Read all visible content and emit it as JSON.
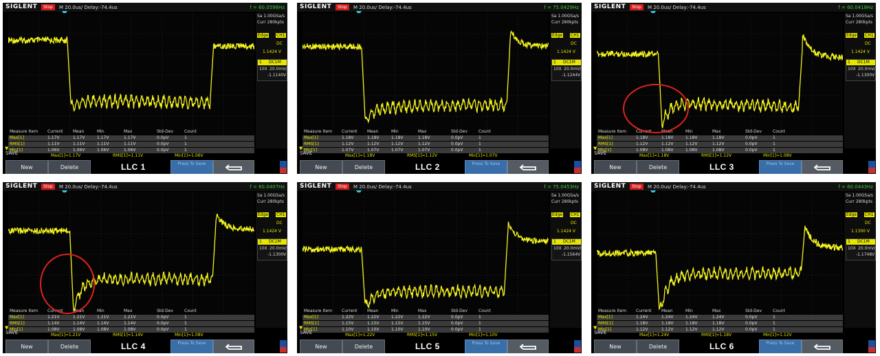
{
  "common": {
    "brand": "SIGLENT",
    "state": "Stop",
    "timebase": "M 20.0us/",
    "delay": "Delay:-74.4us",
    "sample_rate": "Sa 1.00GSa/s",
    "memory": "Curr 280kpts",
    "trigger_type": "Edge",
    "trigger_source": "CH1",
    "coupling": "DC",
    "ch_probe": "10X",
    "ch_scale": "20.0mV/",
    "ch_coupling": "DC1M",
    "ch_num": "1",
    "measure_headers": [
      "Measure Item",
      "Current",
      "Mean",
      "Min",
      "Max",
      "Std-Dev",
      "Count"
    ],
    "measure_names": [
      "Max[1]",
      "RMS[1]",
      "Min[1]"
    ],
    "save_label": "SAVE",
    "btn_new": "New",
    "btn_delete": "Delete",
    "btn_press": "Press To Save",
    "colors": {
      "trace": "#f5f51e",
      "panel": "#000000",
      "accent": "#35c7e8",
      "stop": "#d21d1d",
      "annotation": "#e0231d"
    }
  },
  "panels": [
    {
      "title": "LLC 1",
      "freq": "f = 60.0598Hz",
      "trig_level": "1.1424 V",
      "ch_offset": "-1.1140V",
      "rows": [
        [
          "1.17V",
          "1.17V",
          "1.17V",
          "1.17V",
          "0.0pV",
          "1"
        ],
        [
          "1.11V",
          "1.11V",
          "1.11V",
          "1.11V",
          "0.0pV",
          "1"
        ],
        [
          "1.06V",
          "1.06V",
          "1.06V",
          "1.06V",
          "0.0pV",
          "1"
        ]
      ],
      "stats": [
        "Max[1]=1.17V",
        "RMS[1]=1.11V",
        "Min[1]=1.06V"
      ],
      "trace": {
        "pre": 0.22,
        "dip": 0.75,
        "post_start": 0.71,
        "post_end": 0.72,
        "rise_to": 0.24,
        "step_x": 0.24,
        "rise_x": 0.82,
        "overshoot": 0.0,
        "final": 0.27
      }
    },
    {
      "title": "LLC 2",
      "freq": "f = 75.0429Hz",
      "trig_level": "1.1424 V",
      "ch_offset": "-1.1244V",
      "rows": [
        [
          "1.18V",
          "1.18V",
          "1.18V",
          "1.18V",
          "0.0pV",
          "1"
        ],
        [
          "1.12V",
          "1.12V",
          "1.12V",
          "1.12V",
          "0.0pV",
          "1"
        ],
        [
          "1.07V",
          "1.07V",
          "1.07V",
          "1.07V",
          "0.0pV",
          "1"
        ]
      ],
      "stats": [
        "Max[1]=1.18V",
        "RMS[1]=1.12V",
        "Min[1]=1.07V"
      ],
      "trace": {
        "pre": 0.27,
        "dip": 0.88,
        "post_start": 0.76,
        "post_end": 0.74,
        "rise_to": 0.17,
        "step_x": 0.24,
        "rise_x": 0.83,
        "overshoot": 0.12,
        "final": 0.27
      }
    },
    {
      "title": "LLC 3",
      "freq": "f = 60.0418Hz",
      "trig_level": "1.1424 V",
      "ch_offset": "-1.1300V",
      "rows": [
        [
          "1.18V",
          "1.18V",
          "1.18V",
          "1.18V",
          "0.0pV",
          "1"
        ],
        [
          "1.12V",
          "1.12V",
          "1.12V",
          "1.12V",
          "0.0pV",
          "1"
        ],
        [
          "1.08V",
          "1.08V",
          "1.08V",
          "1.08V",
          "0.0pV",
          "1"
        ]
      ],
      "stats": [
        "Max[1]=1.18V",
        "RMS[1]=1.12V",
        "Min[1]=1.08V"
      ],
      "trace": {
        "pre": 0.33,
        "dip": 0.9,
        "post_start": 0.72,
        "post_end": 0.76,
        "rise_to": 0.3,
        "step_x": 0.25,
        "rise_x": 0.82,
        "overshoot": 0.2,
        "final": 0.36
      }
    },
    {
      "title": "LLC 4",
      "freq": "f = 60.0407Hz",
      "trig_level": "1.1424 V",
      "ch_offset": "-1.1300V",
      "rows": [
        [
          "1.21V",
          "1.21V",
          "1.21V",
          "1.21V",
          "0.0pV",
          "1"
        ],
        [
          "1.14V",
          "1.14V",
          "1.14V",
          "1.14V",
          "0.0pV",
          "1"
        ],
        [
          "1.08V",
          "1.08V",
          "1.08V",
          "1.08V",
          "0.0pV",
          "1"
        ]
      ],
      "stats": [
        "Max[1]=1.21V",
        "RMS[1]=1.14V",
        "Min[1]=1.08V"
      ],
      "trace": {
        "pre": 0.31,
        "dip": 0.95,
        "post_start": 0.7,
        "post_end": 0.7,
        "rise_to": 0.2,
        "step_x": 0.25,
        "rise_x": 0.83,
        "overshoot": 0.12,
        "final": 0.3
      }
    },
    {
      "title": "LLC 5",
      "freq": "f = 75.0453Hz",
      "trig_level": "1.1424 V",
      "ch_offset": "-1.1564V",
      "rows": [
        [
          "1.22V",
          "1.22V",
          "1.22V",
          "1.22V",
          "0.0pV",
          "1"
        ],
        [
          "1.15V",
          "1.15V",
          "1.15V",
          "1.15V",
          "0.0pV",
          "1"
        ],
        [
          "1.10V",
          "1.10V",
          "1.10V",
          "1.10V",
          "0.0pV",
          "1"
        ]
      ],
      "stats": [
        "Max[1]=1.22V",
        "RMS[1]=1.15V",
        "Min[1]=1.10V"
      ],
      "trace": {
        "pre": 0.46,
        "dip": 0.93,
        "post_start": 0.8,
        "post_end": 0.8,
        "rise_to": 0.3,
        "step_x": 0.24,
        "rise_x": 0.82,
        "overshoot": 0.17,
        "final": 0.4
      }
    },
    {
      "title": "LLC 6",
      "freq": "f = 60.0443Hz",
      "trig_level": "1.1300 V",
      "ch_offset": "-1.1748V",
      "rows": [
        [
          "1.24V",
          "1.24V",
          "1.24V",
          "1.24V",
          "0.0pV",
          "1"
        ],
        [
          "1.18V",
          "1.18V",
          "1.18V",
          "1.18V",
          "0.0pV",
          "1"
        ],
        [
          "1.12V",
          "1.12V",
          "1.12V",
          "1.12V",
          "0.0pV",
          "1"
        ]
      ],
      "stats": [
        "Max[1]=1.24V",
        "RMS[1]=1.18V",
        "Min[1]=1.12V"
      ],
      "trace": {
        "pre": 0.49,
        "dip": 0.98,
        "post_start": 0.66,
        "post_end": 0.65,
        "rise_to": 0.3,
        "step_x": 0.24,
        "rise_x": 0.83,
        "overshoot": 0.18,
        "final": 0.45
      }
    }
  ]
}
